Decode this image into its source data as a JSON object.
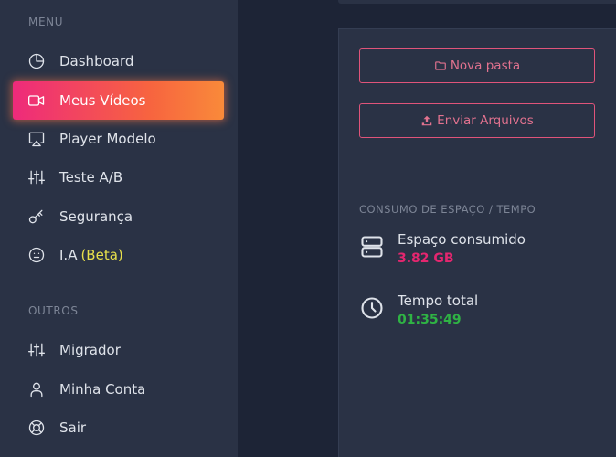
{
  "sidebar": {
    "menu_title": "MENU",
    "menu_items": [
      {
        "label": "Dashboard",
        "icon": "pie-chart-icon"
      },
      {
        "label": "Meus Vídeos",
        "icon": "video-camera-icon",
        "active": true
      },
      {
        "label": "Player Modelo",
        "icon": "monitor-play-icon"
      },
      {
        "label": "Teste A/B",
        "icon": "sliders-icon"
      },
      {
        "label": "Segurança",
        "icon": "key-icon"
      },
      {
        "label": "I.A",
        "badge": "(Beta)",
        "icon": "smiley-icon"
      }
    ],
    "others_title": "OUTROS",
    "other_items": [
      {
        "label": "Migrador",
        "icon": "sliders-icon"
      },
      {
        "label": "Minha Conta",
        "icon": "user-icon"
      },
      {
        "label": "Sair",
        "icon": "lifebuoy-icon"
      }
    ]
  },
  "panel": {
    "new_folder_label": "Nova pasta",
    "upload_label": "Enviar Arquivos",
    "usage_title": "CONSUMO DE ESPAÇO / TEMPO",
    "storage": {
      "label": "Espaço consumido",
      "value": "3.82 GB",
      "color": "#e4266f"
    },
    "time": {
      "label": "Tempo total",
      "value": "01:35:49",
      "color": "#2fb344"
    }
  },
  "colors": {
    "active_gradient_start": "#ee2a7b",
    "active_gradient_end": "#f98a3a",
    "button_border": "#e0547a",
    "beta": "#e8e04b"
  }
}
